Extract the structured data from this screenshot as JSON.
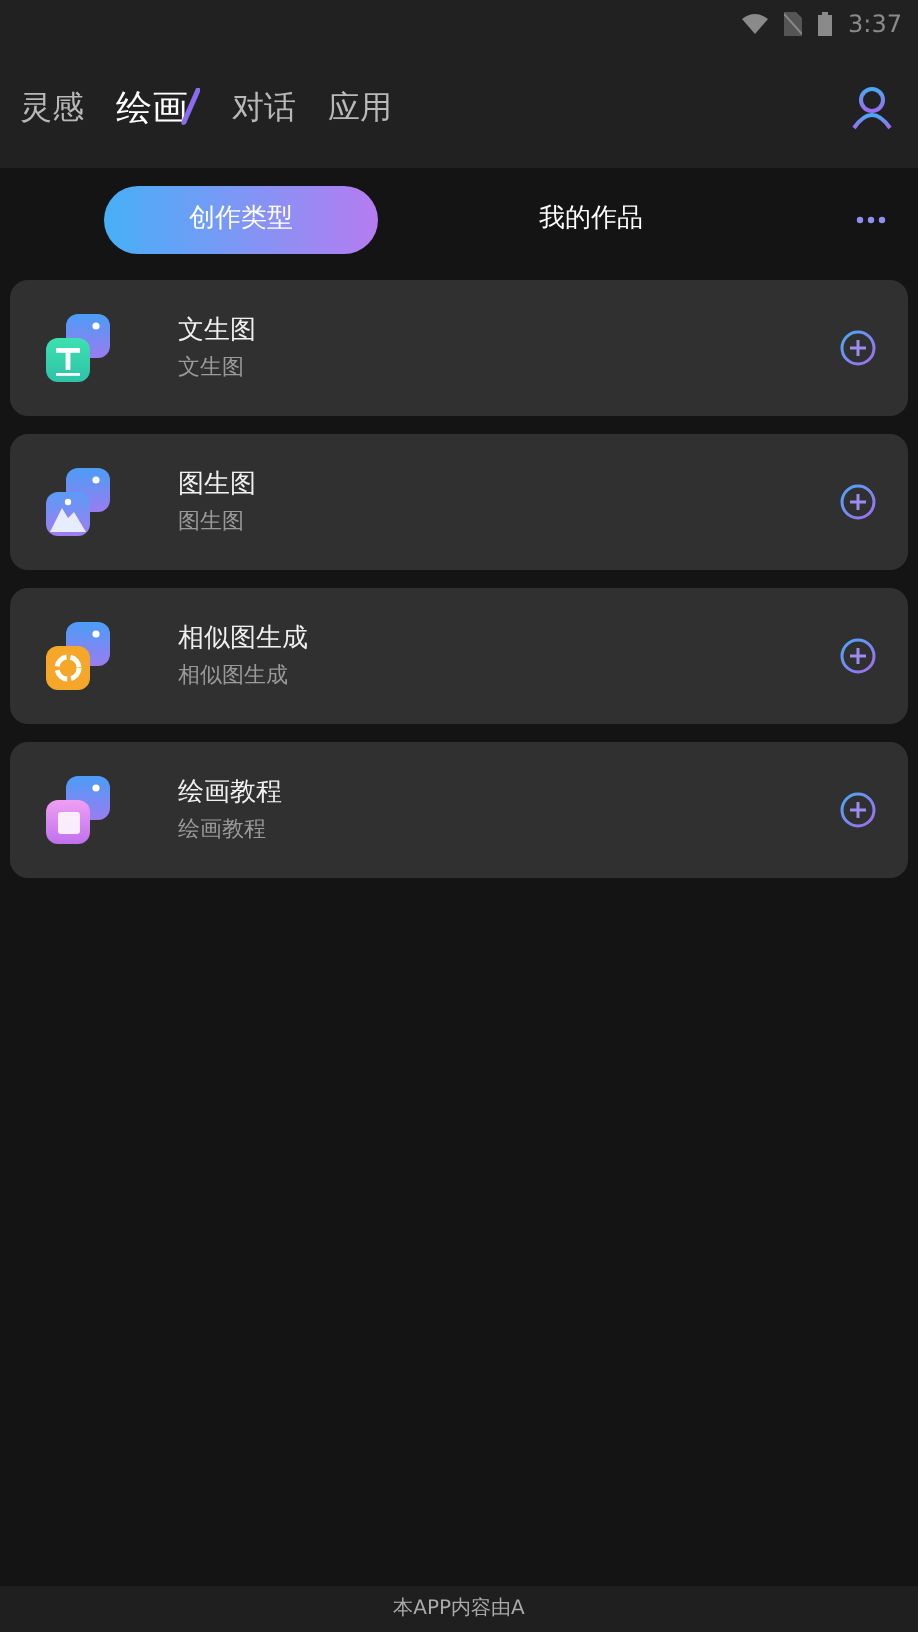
{
  "status_bar": {
    "time": "3:37"
  },
  "tabs": [
    {
      "label": "灵感",
      "selected": false
    },
    {
      "label": "绘画",
      "selected": true
    },
    {
      "label": "对话",
      "selected": false
    },
    {
      "label": "应用",
      "selected": false
    }
  ],
  "segments": [
    {
      "label": "创作类型",
      "selected": true
    },
    {
      "label": "我的作品",
      "selected": false
    }
  ],
  "cards": [
    {
      "kind": "text",
      "title": "文生图",
      "subtitle": "文生图"
    },
    {
      "kind": "image",
      "title": "图生图",
      "subtitle": "图生图"
    },
    {
      "kind": "similar",
      "title": "相似图生成",
      "subtitle": "相似图生成"
    },
    {
      "kind": "tutorial",
      "title": "绘画教程",
      "subtitle": "绘画教程"
    }
  ],
  "footer": "本APP内容由A"
}
